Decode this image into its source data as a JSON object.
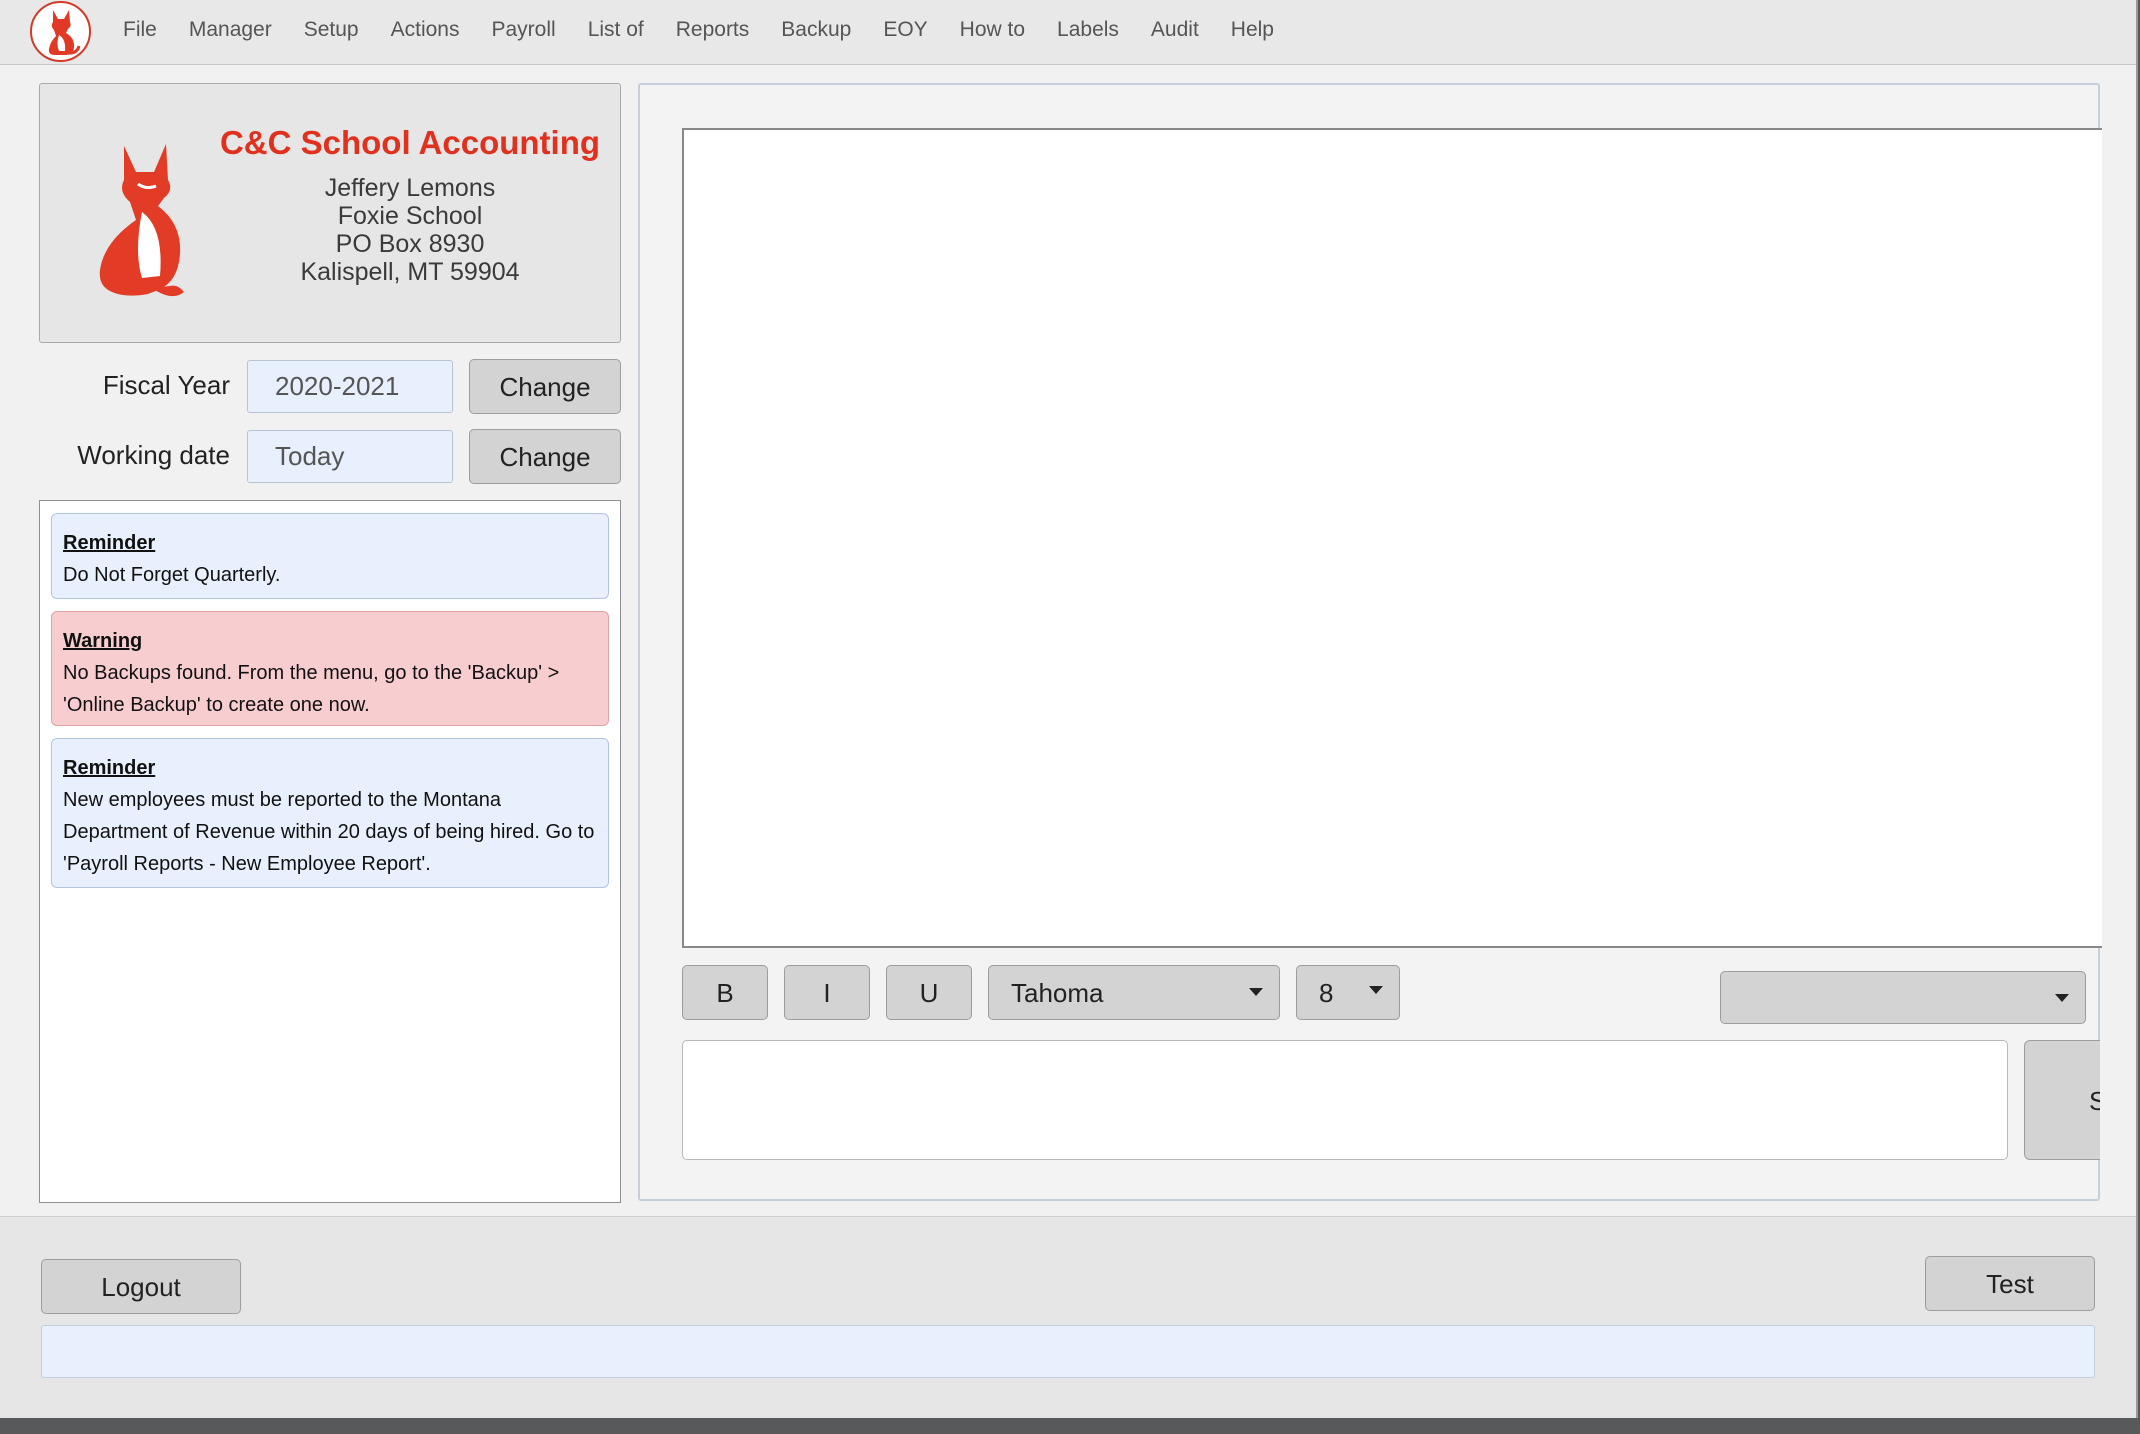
{
  "menu": {
    "items": [
      "File",
      "Manager",
      "Setup",
      "Actions",
      "Payroll",
      "List of",
      "Reports",
      "Backup",
      "EOY",
      "How to",
      "Labels",
      "Audit",
      "Help"
    ]
  },
  "brand": {
    "title": "C&C School Accounting",
    "address": [
      "Jeffery Lemons",
      "Foxie School",
      "PO Box 8930",
      "Kalispell, MT 59904"
    ],
    "accent_color": "#e0301e"
  },
  "fiscal_year": {
    "label": "Fiscal Year",
    "value": "2020-2021",
    "change_label": "Change"
  },
  "working_date": {
    "label": "Working date",
    "value": "Today",
    "change_label": "Change"
  },
  "messages": [
    {
      "type": "reminder",
      "title": "Reminder",
      "text": "Do Not Forget Quarterly."
    },
    {
      "type": "warning",
      "title": "Warning",
      "text": "No Backups found. From the menu, go to the 'Backup' > 'Online Backup' to create one now."
    },
    {
      "type": "reminder",
      "title": "Reminder",
      "text": "New employees must be reported to the Montana Department of Revenue within 20 days of being hired. Go to 'Payroll Reports - New Employee Report'."
    }
  ],
  "editor": {
    "bold_label": "B",
    "italic_label": "I",
    "underline_label": "U",
    "font_family": "Tahoma",
    "font_size": "8",
    "style_select": "",
    "compose_value": "",
    "send_label": "S"
  },
  "footer": {
    "logout_label": "Logout",
    "test_label": "Test",
    "status_text": ""
  }
}
